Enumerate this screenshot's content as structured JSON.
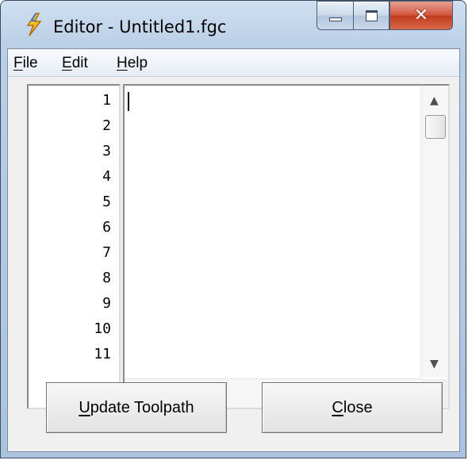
{
  "window": {
    "title": "Editor - Untitled1.fgc",
    "icon": "lightning-bolt-icon",
    "caption_buttons": {
      "minimize": "minimize-icon",
      "maximize": "maximize-icon",
      "close": "close-icon"
    }
  },
  "menubar": {
    "items": [
      {
        "accel": "F",
        "rest": "ile"
      },
      {
        "accel": "E",
        "rest": "dit"
      },
      {
        "accel": "H",
        "rest": "elp"
      }
    ]
  },
  "editor": {
    "line_numbers": [
      "1",
      "2",
      "3",
      "4",
      "5",
      "6",
      "7",
      "8",
      "9",
      "10",
      "11"
    ],
    "content": ""
  },
  "buttons": {
    "update": {
      "accel": "U",
      "rest": "pdate Toolpath"
    },
    "close": {
      "accel": "C",
      "rest": "lose"
    }
  },
  "colors": {
    "titlebar": "#cfdff0",
    "close_button": "#c9452b",
    "client_background": "#f0f0f0"
  }
}
